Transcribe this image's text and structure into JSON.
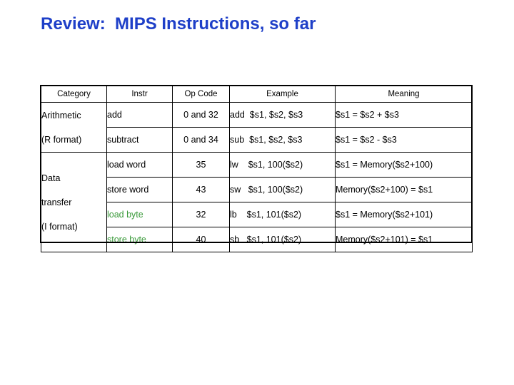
{
  "slide": {
    "title": "Review:  MIPS Instructions, so far",
    "title_color": "#1e3fc8",
    "background": "#ffffff"
  },
  "table": {
    "headers": [
      "Category",
      "Instr",
      "Op Code",
      "Example",
      "Meaning"
    ],
    "category_groups": [
      {
        "lines": [
          "Arithmetic",
          "(R format)"
        ],
        "rowspan": 2
      },
      {
        "lines": [
          "Data",
          "transfer",
          "(I format)"
        ],
        "rowspan": 4
      }
    ],
    "rows": [
      {
        "instr": "add",
        "opcode": "0 and 32",
        "example": "add  $s1, $s2, $s3",
        "meaning": "$s1 = $s2 + $s3",
        "highlight": false
      },
      {
        "instr": "subtract",
        "opcode": "0 and 34",
        "example": "sub  $s1, $s2, $s3",
        "meaning": "$s1 = $s2 - $s3",
        "highlight": false
      },
      {
        "instr": "load word",
        "opcode": "35",
        "example": "lw    $s1, 100($s2)",
        "meaning": "$s1 = Memory($s2+100)",
        "highlight": false
      },
      {
        "instr": "store word",
        "opcode": "43",
        "example": "sw   $s1, 100($s2)",
        "meaning": "Memory($s2+100) = $s1",
        "highlight": false
      },
      {
        "instr": "load byte",
        "opcode": "32",
        "example": "lb    $s1, 101($s2)",
        "meaning": "$s1 = Memory($s2+101)",
        "highlight": true
      },
      {
        "instr": "store byte",
        "opcode": "40",
        "example": "sb   $s1, 101($s2)",
        "meaning": "Memory($s2+101) = $s1",
        "highlight": true
      }
    ],
    "highlight_color": "#3a9a3a"
  }
}
